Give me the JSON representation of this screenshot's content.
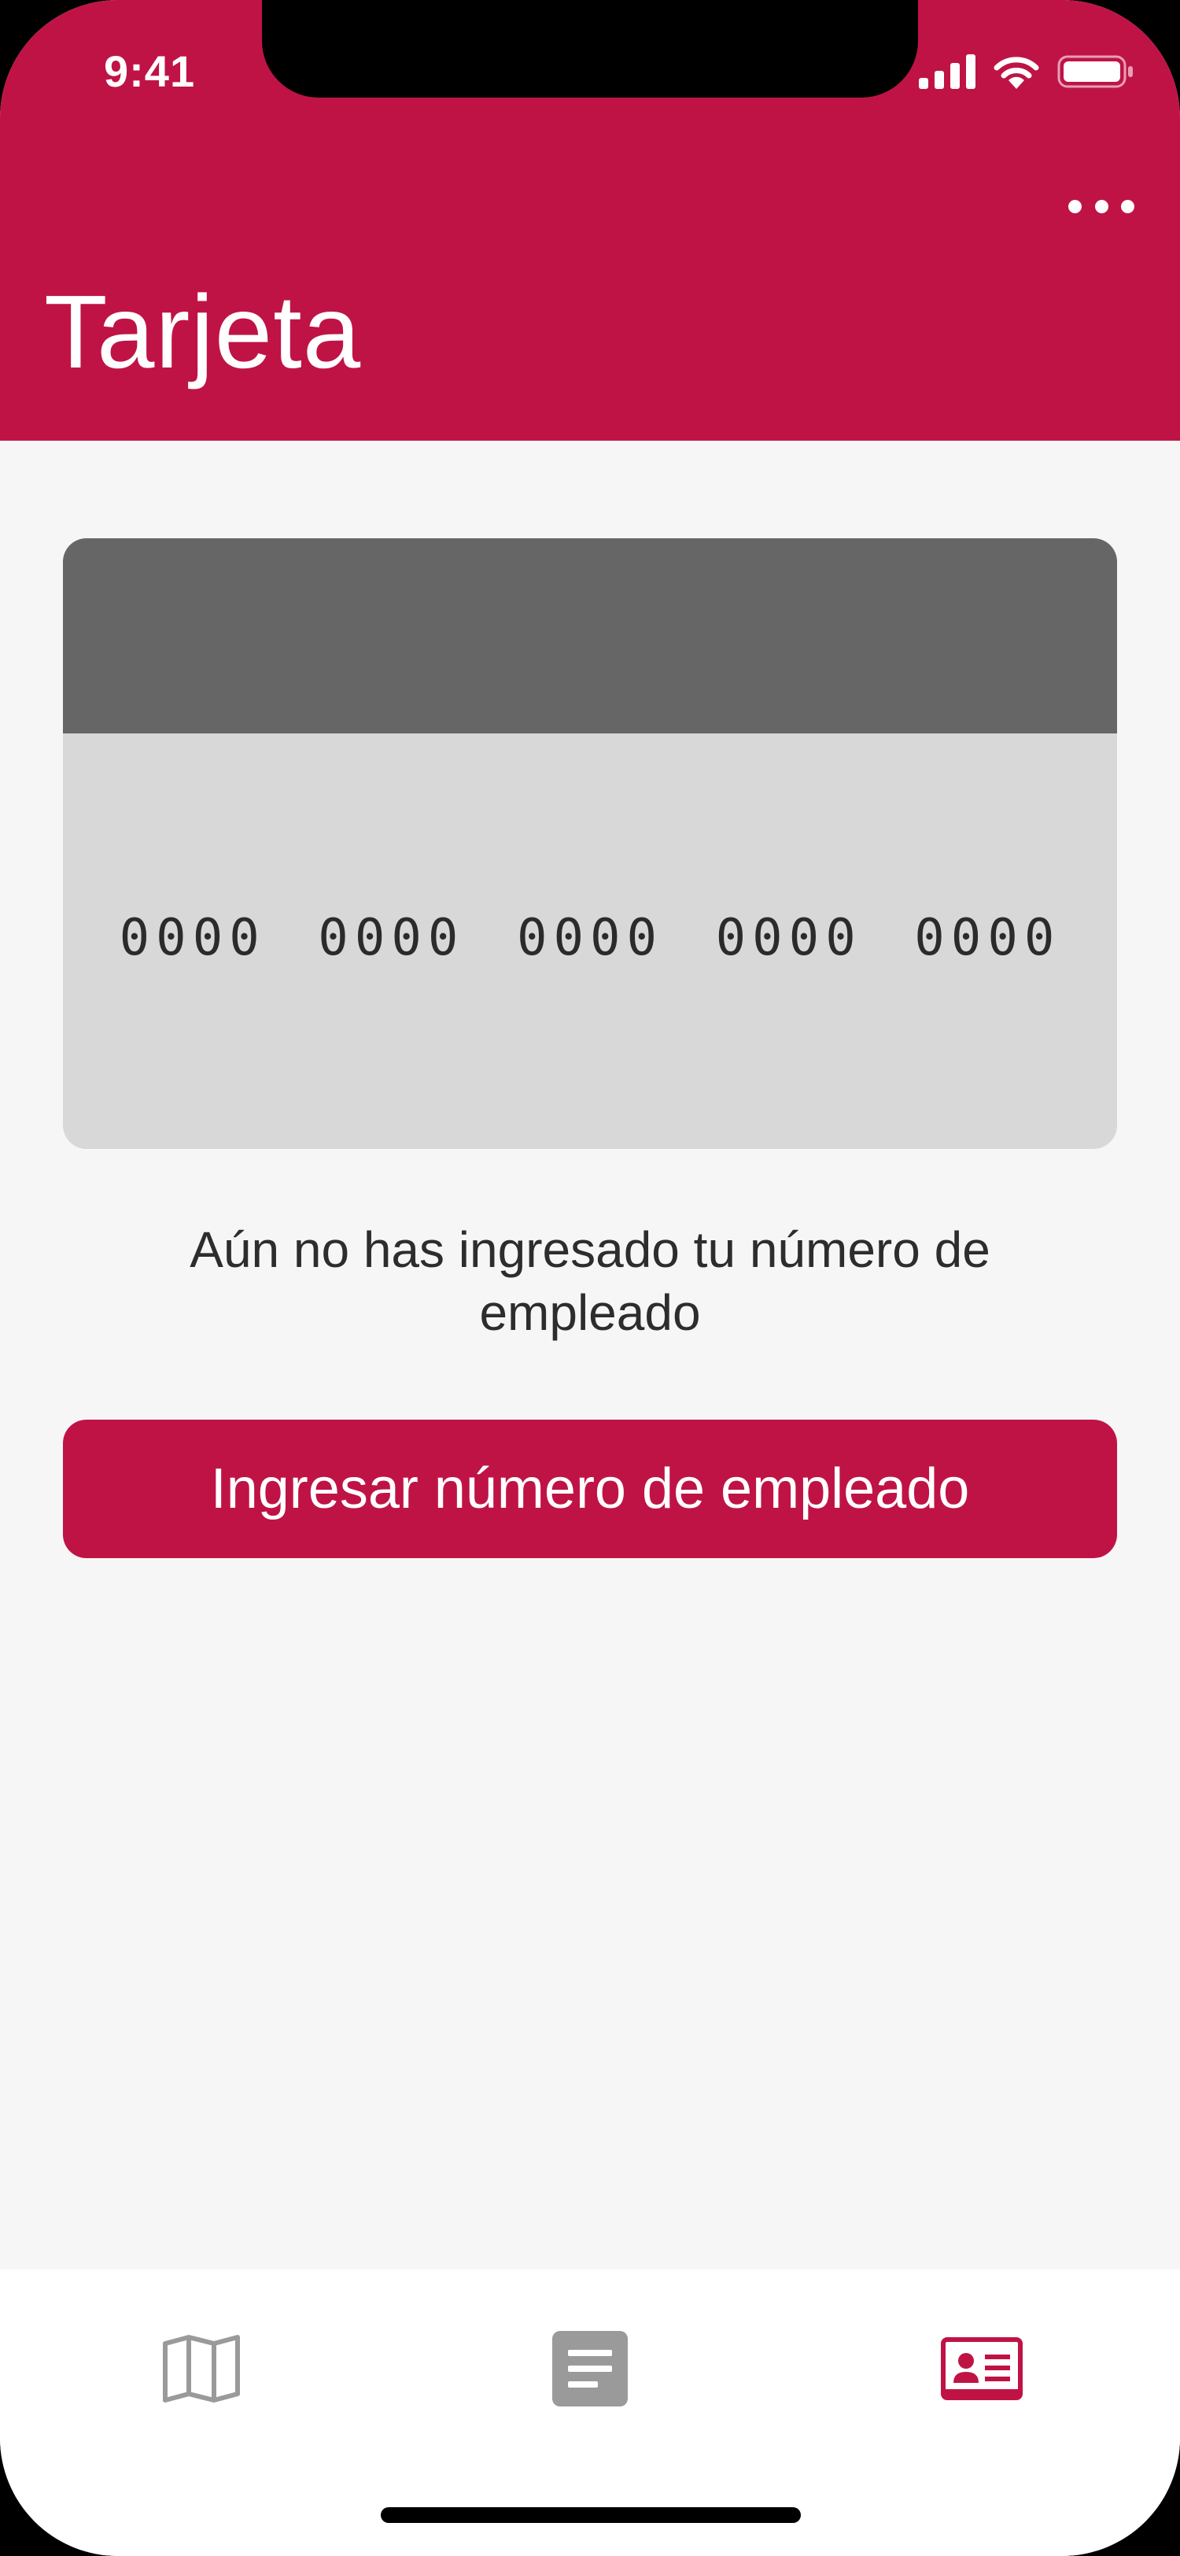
{
  "status_bar": {
    "time": "9:41"
  },
  "header": {
    "title": "Tarjeta",
    "more_icon": "more-horizontal-icon"
  },
  "card": {
    "number": "0000 0000 0000 0000 0000"
  },
  "message": "Aún no has ingresado tu número de empleado",
  "primary_button": {
    "label": "Ingresar número de empleado"
  },
  "tabbar": {
    "items": [
      {
        "icon": "map-icon",
        "active": false
      },
      {
        "icon": "document-icon",
        "active": false
      },
      {
        "icon": "id-card-icon",
        "active": true
      }
    ]
  },
  "colors": {
    "brand": "#bf1346",
    "background": "#f6f6f6",
    "card_strip": "#666666",
    "card_body": "#d8d8d8",
    "tab_inactive": "#9a9a9a"
  }
}
